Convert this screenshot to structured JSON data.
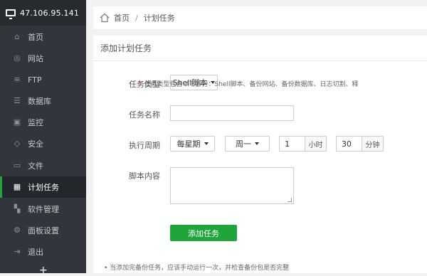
{
  "sidebar": {
    "server_ip": "47.106.95.141",
    "badge_count": "0",
    "items": [
      {
        "label": "首页",
        "icon": "home-icon"
      },
      {
        "label": "网站",
        "icon": "globe-icon"
      },
      {
        "label": "FTP",
        "icon": "ftp-icon"
      },
      {
        "label": "数据库",
        "icon": "database-icon"
      },
      {
        "label": "监控",
        "icon": "monitor-icon"
      },
      {
        "label": "安全",
        "icon": "shield-icon"
      },
      {
        "label": "文件",
        "icon": "folder-icon"
      },
      {
        "label": "计划任务",
        "icon": "calendar-icon"
      },
      {
        "label": "软件管理",
        "icon": "grid-icon"
      },
      {
        "label": "面板设置",
        "icon": "gear-icon"
      },
      {
        "label": "退出",
        "icon": "logout-icon"
      }
    ],
    "active_index": 7,
    "add_label": "+"
  },
  "breadcrumb": {
    "home": "首页",
    "separator": "/",
    "current": "计划任务"
  },
  "panel": {
    "title": "添加计划任务"
  },
  "form": {
    "task_type_label": "任务类型",
    "task_type_value": "Shell脚本",
    "task_type_hint_star": "*",
    "task_type_hint": "任务类型包含以下部分：Shell脚本、备份网站、备份数据库、日志切割、释",
    "task_name_label": "任务名称",
    "task_name_value": "",
    "period_label": "执行周期",
    "period_value": "每星期",
    "weekday_value": "周一",
    "hour_value": "1",
    "hour_unit": "小时",
    "minute_value": "30",
    "minute_unit": "分钟",
    "script_label": "脚本内容",
    "script_value": "",
    "submit_label": "添加任务"
  },
  "notes": [
    "当添加完备份任务，应该手动运行一次，并检查备份包是否完整"
  ],
  "colors": {
    "sidebar_bg": "#32363c",
    "accent_green": "#20a53a",
    "badge_orange": "#f0883e"
  }
}
